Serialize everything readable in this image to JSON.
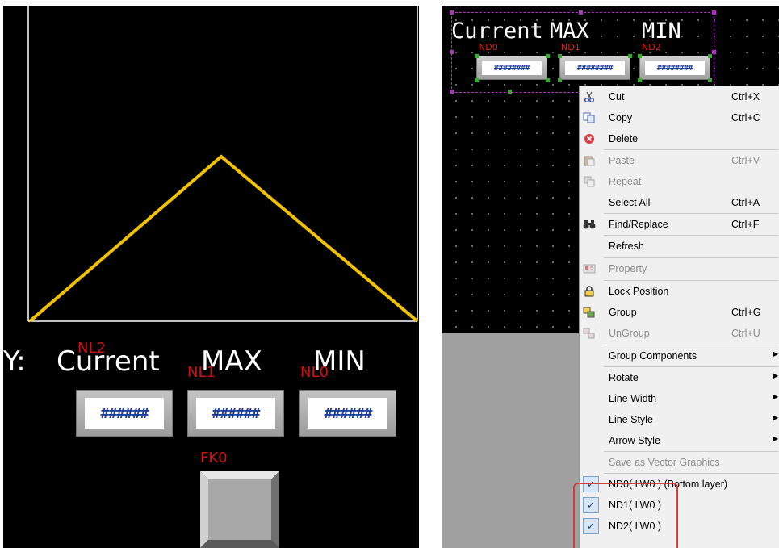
{
  "left_panel": {
    "y_label": "Y:",
    "labels": [
      "Current",
      "MAX",
      "MIN"
    ],
    "tags": [
      "NL2",
      "NL1",
      "NL0"
    ],
    "display_value": "######",
    "fk_tag": "FK0",
    "trend_color": "#f2c200"
  },
  "right_panel": {
    "title_current": "Current",
    "title_max": "MAX",
    "title_min": "MIN",
    "nd_tags": [
      "ND0",
      "ND1",
      "ND2"
    ],
    "display_value": "########"
  },
  "context_menu": {
    "items": [
      {
        "icon": "scissors-icon",
        "label": "Cut",
        "shortcut": "Ctrl+X",
        "enabled": true
      },
      {
        "icon": "copy-icon",
        "label": "Copy",
        "shortcut": "Ctrl+C",
        "enabled": true
      },
      {
        "icon": "delete-icon",
        "label": "Delete",
        "shortcut": "",
        "enabled": true
      },
      {
        "icon": "paste-icon",
        "label": "Paste",
        "shortcut": "Ctrl+V",
        "enabled": false
      },
      {
        "icon": "repeat-icon",
        "label": "Repeat",
        "shortcut": "",
        "enabled": false
      },
      {
        "icon": "",
        "label": "Select All",
        "shortcut": "Ctrl+A",
        "enabled": true
      },
      {
        "icon": "binoculars-icon",
        "label": "Find/Replace",
        "shortcut": "Ctrl+F",
        "enabled": true
      },
      {
        "icon": "",
        "label": "Refresh",
        "shortcut": "",
        "enabled": true
      },
      {
        "icon": "property-icon",
        "label": "Property",
        "shortcut": "",
        "enabled": false
      },
      {
        "icon": "lock-icon",
        "label": "Lock Position",
        "shortcut": "",
        "enabled": true
      },
      {
        "icon": "group-icon",
        "label": "Group",
        "shortcut": "Ctrl+G",
        "enabled": true
      },
      {
        "icon": "ungroup-icon",
        "label": "UnGroup",
        "shortcut": "Ctrl+U",
        "enabled": false
      },
      {
        "icon": "",
        "label": "Group Components",
        "shortcut": "",
        "enabled": true
      },
      {
        "icon": "",
        "label": "Rotate",
        "shortcut": "",
        "enabled": true
      },
      {
        "icon": "",
        "label": "Line Width",
        "shortcut": "",
        "enabled": true
      },
      {
        "icon": "",
        "label": "Line Style",
        "shortcut": "",
        "enabled": true
      },
      {
        "icon": "",
        "label": "Arrow Style",
        "shortcut": "",
        "enabled": true
      },
      {
        "icon": "",
        "label": "Save as Vector Graphics",
        "shortcut": "",
        "enabled": false
      },
      {
        "icon": "checkmark-icon",
        "label": "ND0( LW0 ) (Bottom layer)",
        "shortcut": "",
        "enabled": true
      },
      {
        "icon": "checkmark-icon",
        "label": "ND1( LW0 )",
        "shortcut": "",
        "enabled": true
      },
      {
        "icon": "checkmark-icon",
        "label": "ND2( LW0 )",
        "shortcut": "",
        "enabled": true
      }
    ],
    "highlight_color": "#d43b3b"
  }
}
